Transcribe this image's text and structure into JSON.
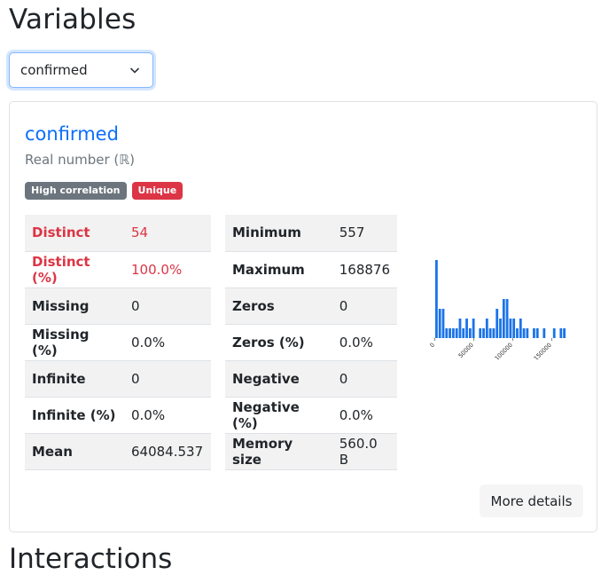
{
  "page": {
    "title": "Variables",
    "next_section_title": "Interactions"
  },
  "selector": {
    "value": "confirmed"
  },
  "variable": {
    "name": "confirmed",
    "type": "Real number (ℝ)",
    "badges": [
      "High correlation",
      "Unique"
    ]
  },
  "stats_left": [
    {
      "label": "Distinct",
      "value": "54",
      "alert": true
    },
    {
      "label": "Distinct (%)",
      "value": "100.0%",
      "alert": true
    },
    {
      "label": "Missing",
      "value": "0",
      "alert": false
    },
    {
      "label": "Missing (%)",
      "value": "0.0%",
      "alert": false
    },
    {
      "label": "Infinite",
      "value": "0",
      "alert": false
    },
    {
      "label": "Infinite (%)",
      "value": "0.0%",
      "alert": false
    },
    {
      "label": "Mean",
      "value": "64084.537",
      "alert": false
    }
  ],
  "stats_right": [
    {
      "label": "Minimum",
      "value": "557"
    },
    {
      "label": "Maximum",
      "value": "168876"
    },
    {
      "label": "Zeros",
      "value": "0"
    },
    {
      "label": "Zeros (%)",
      "value": "0.0%"
    },
    {
      "label": "Negative",
      "value": "0"
    },
    {
      "label": "Negative (%)",
      "value": "0.0%"
    },
    {
      "label": "Memory size",
      "value": "560.0 B"
    }
  ],
  "more_details_label": "More details",
  "colors": {
    "accent": "#0d6efd",
    "alert": "#dc3545",
    "badge_gray": "#6c757d",
    "bar": "#1a73e8"
  },
  "chart_data": {
    "type": "bar",
    "x_ticks": [
      "0",
      "50000",
      "100000",
      "150000"
    ],
    "x_range": [
      557,
      168876
    ],
    "bin_counts": [
      8,
      3,
      3,
      1,
      1,
      1,
      1,
      2,
      1,
      2,
      1,
      2,
      0,
      1,
      1,
      2,
      1,
      1,
      3,
      2,
      4,
      4,
      2,
      2,
      1,
      2,
      1,
      1,
      0,
      1,
      1,
      0,
      1,
      0,
      0,
      1,
      0,
      1,
      1
    ]
  }
}
